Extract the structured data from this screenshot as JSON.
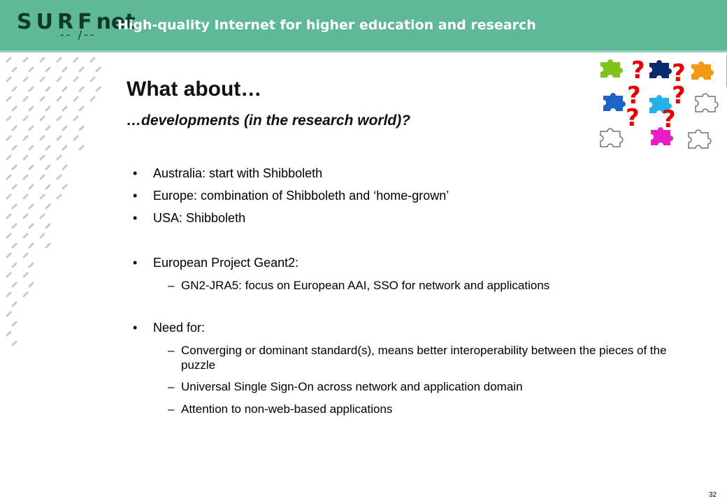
{
  "header": {
    "logo_text": "SURF",
    "logo_net": "net",
    "logo_mark": "-- /--",
    "tagline": "High-quality Internet for higher education and research"
  },
  "slide": {
    "title": "What about…",
    "subtitle": "…developments (in the research world)?",
    "puzzle_marks": [
      "?",
      "?",
      "?",
      "?",
      "?",
      "?"
    ],
    "bullets": [
      {
        "text": "Australia: start with Shibboleth"
      },
      {
        "text": "Europe: combination of Shibboleth and ‘home-grown’"
      },
      {
        "text": "USA: Shibboleth"
      },
      {
        "text": "European Project Geant2:"
      },
      {
        "text": "Need for:"
      }
    ],
    "sub_bullets": [
      {
        "text": "GN2-JRA5: focus on European AAI, SSO for network and applications"
      },
      {
        "text": "Converging or dominant standard(s), means better interoperability between the pieces of the puzzle"
      },
      {
        "text": "Universal Single Sign-On across network and application domain"
      },
      {
        "text": "Attention to non-web-based applications"
      }
    ],
    "bullet_glyph": "•",
    "dash_glyph": "–",
    "page_number": "32"
  },
  "colors": {
    "banner": "#5fb999",
    "question_mark": "#e60000",
    "puzzle_green": "#7fc31c",
    "puzzle_navy": "#0b2a6e",
    "puzzle_orange": "#f39a12",
    "puzzle_blue": "#1e63c8",
    "puzzle_cyan": "#21b3e8",
    "puzzle_magenta": "#e61ec8"
  },
  "icons": [
    "surfnet-logo",
    "dash-pattern",
    "puzzle-pieces-image"
  ]
}
